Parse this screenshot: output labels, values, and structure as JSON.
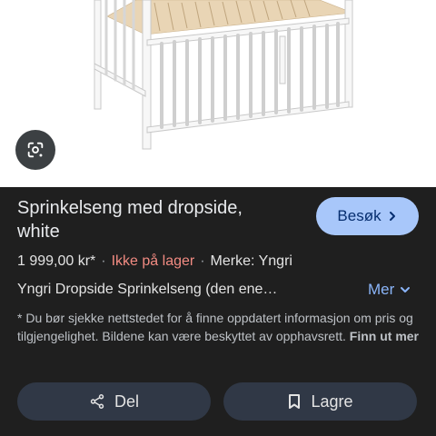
{
  "product": {
    "title": "Sprinkelseng med dropside, white",
    "price": "1 999,00 kr*",
    "separator": "·",
    "stock_status": "Ikke på lager",
    "brand": "Merke: Yngri",
    "description": "Yngri Dropside Sprinkelseng (den ene…",
    "disclaimer": "* Du bør sjekke nettstedet for å finne oppdatert informasjon om pris og tilgjengelighet. Bildene kan være beskyttet av opphavsrett.",
    "learn_more": "Finn ut mer"
  },
  "buttons": {
    "visit": "Besøk",
    "more": "Mer",
    "share": "Del",
    "save": "Lagre"
  },
  "icons": {
    "lens": "lens-icon",
    "visit": "chevron-right-icon",
    "more": "chevron-down-icon",
    "share": "share-icon",
    "save": "bookmark-icon"
  },
  "colors": {
    "background": "#1f1f1f",
    "visit_button": "#a8c7fa",
    "stock_status": "#f28b82",
    "link_blue": "#8ab4f8",
    "action_button": "#303846"
  }
}
